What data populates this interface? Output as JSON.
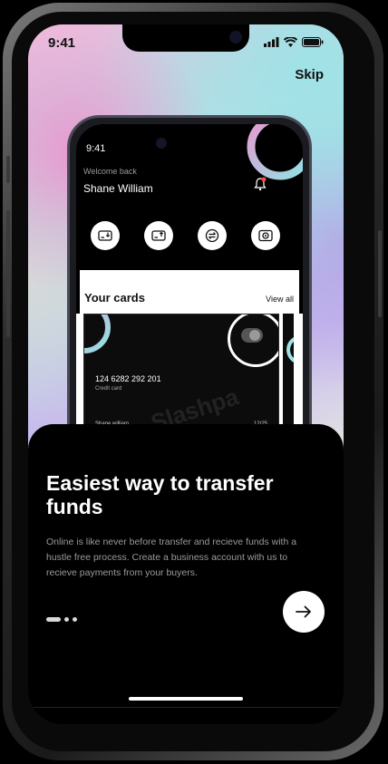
{
  "status_bar": {
    "time": "9:41"
  },
  "header": {
    "skip_label": "Skip"
  },
  "mock_app": {
    "time": "9:41",
    "welcome": "Welcome back",
    "user_name": "Shane William",
    "cards_title": "Your cards",
    "view_all": "View all",
    "card": {
      "number": "124 6282 292 201",
      "type": "Credit card",
      "holder": "Shane william",
      "expiry": "12/25",
      "brand": "Slashpa"
    },
    "actions": [
      "receive-icon",
      "send-icon",
      "transfer-icon",
      "camera-icon"
    ]
  },
  "onboarding": {
    "title": "Easiest way to transfer funds",
    "description": "Online is like never before transfer and recieve funds with a hustle free process. Create a business account with us to recieve payments from your buyers.",
    "page_index": 1,
    "page_count": 3
  },
  "colors": {
    "background": "#000000",
    "accent_pink": "#e89ad0",
    "accent_cyan": "#9fe2e6"
  }
}
